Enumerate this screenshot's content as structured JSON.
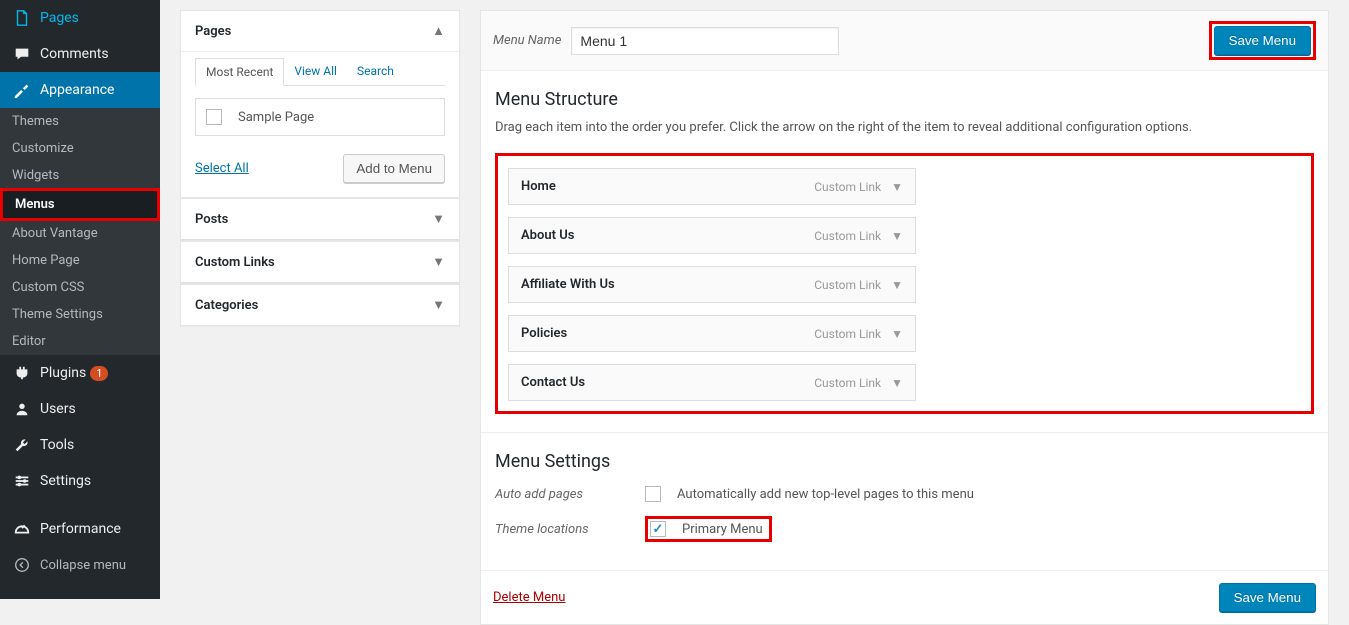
{
  "sidebar": {
    "items": [
      {
        "icon": "pages",
        "label": "Pages"
      },
      {
        "icon": "comments",
        "label": "Comments"
      },
      {
        "icon": "appearance",
        "label": "Appearance",
        "current": true
      },
      {
        "icon": "plugins",
        "label": "Plugins",
        "badge": "1"
      },
      {
        "icon": "users",
        "label": "Users"
      },
      {
        "icon": "tools",
        "label": "Tools"
      },
      {
        "icon": "settings",
        "label": "Settings"
      },
      {
        "icon": "performance",
        "label": "Performance"
      }
    ],
    "submenu": [
      "Themes",
      "Customize",
      "Widgets",
      "Menus",
      "About Vantage",
      "Home Page",
      "Custom CSS",
      "Theme Settings",
      "Editor"
    ],
    "submenu_current": "Menus",
    "collapse": "Collapse menu"
  },
  "leftcol": {
    "accordions": [
      {
        "title": "Pages",
        "open": true
      },
      {
        "title": "Posts",
        "open": false
      },
      {
        "title": "Custom Links",
        "open": false
      },
      {
        "title": "Categories",
        "open": false
      }
    ],
    "tabs": [
      "Most Recent",
      "View All",
      "Search"
    ],
    "tabs_active": "Most Recent",
    "page_item": "Sample Page",
    "select_all": "Select All",
    "add_to_menu": "Add to Menu"
  },
  "main": {
    "menu_name_label": "Menu Name",
    "menu_name_value": "Menu 1",
    "save_menu": "Save Menu",
    "structure_title": "Menu Structure",
    "structure_desc": "Drag each item into the order you prefer. Click the arrow on the right of the item to reveal additional configuration options.",
    "items": [
      {
        "title": "Home",
        "type": "Custom Link"
      },
      {
        "title": "About Us",
        "type": "Custom Link"
      },
      {
        "title": "Affiliate With Us",
        "type": "Custom Link"
      },
      {
        "title": "Policies",
        "type": "Custom Link"
      },
      {
        "title": "Contact Us",
        "type": "Custom Link"
      }
    ],
    "settings_title": "Menu Settings",
    "auto_add_label": "Auto add pages",
    "auto_add_checkbox": "Automatically add new top-level pages to this menu",
    "theme_loc_label": "Theme locations",
    "theme_loc_checkbox": "Primary Menu",
    "delete_menu": "Delete Menu"
  }
}
